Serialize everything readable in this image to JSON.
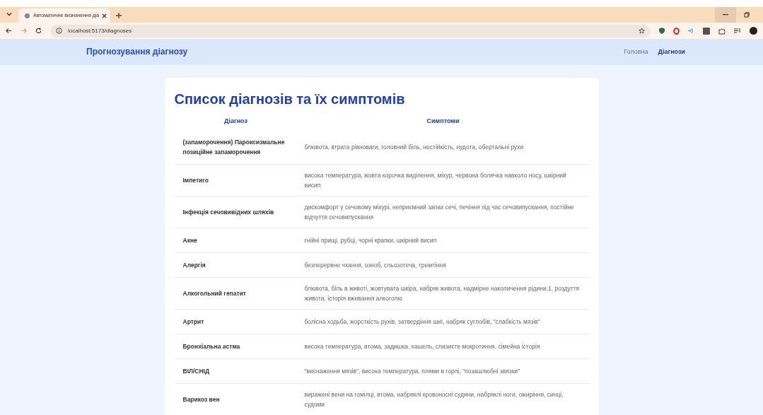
{
  "browser": {
    "tab_title": "Автоматичне визначення діа",
    "address": "localhost:5173/diagnoses"
  },
  "header": {
    "brand": "Прогнозування діагнозу",
    "nav": [
      {
        "label": "Головна",
        "selected": false
      },
      {
        "label": "Діагнози",
        "selected": true
      }
    ]
  },
  "page": {
    "title": "Список діагнозів та їх симптомів"
  },
  "table": {
    "columns": [
      "Діагноз",
      "Симптоми"
    ],
    "rows": [
      {
        "diagnosis": "(запаморочення) Пароксизмальне позиційне запаморочення",
        "symptoms": "блювота, втрата рівноваги, головний біль, нестійкість, нудота, обертальні рухи"
      },
      {
        "diagnosis": "Імпетиго",
        "symptoms": "висока температура, жовта корочка виділення, міхур, червона болячка навколо носу, шкірний висип"
      },
      {
        "diagnosis": "Інфекція сечовивідних шляхів",
        "symptoms": "дискомфорт у сечовому міхурі, неприємний запах сечі, печіння під час сечовипускання, постійне відчуття сечовипускання"
      },
      {
        "diagnosis": "Акне",
        "symptoms": "гнійні прищі, рубці, чорні крапки, шкірний висип"
      },
      {
        "diagnosis": "Алергія",
        "symptoms": "безперервне чхання, озноб, сльозотеча, тремтіння"
      },
      {
        "diagnosis": "Алкогольний гепатит",
        "symptoms": "блювота, біль в животі, жовтувата шкіра, набряк живота, надмірне накопичення рідини.1, роздуття живота, історія вживання алкоголю"
      },
      {
        "diagnosis": "Артрит",
        "symptoms": "болісна ходьба, жорсткість рухів, затвердіння шиї, набряк суглобів, \"слабкість мязів\""
      },
      {
        "diagnosis": "Бронхіальна астма",
        "symptoms": "висока температура, втома, задишка, кашель, слизисте мокротиння, сімейна історія"
      },
      {
        "diagnosis": "ВІЛ/СНІД",
        "symptoms": "\"виснаження мязів\", висока температура, плями в горлі, \"позашлюбні звязки\""
      },
      {
        "diagnosis": "Варикоз вен",
        "symptoms": "виражені вени на гомілці, втома, набряклі кровоносні судини, набряклі ноги, ожиріння, синці, судоми"
      }
    ]
  }
}
